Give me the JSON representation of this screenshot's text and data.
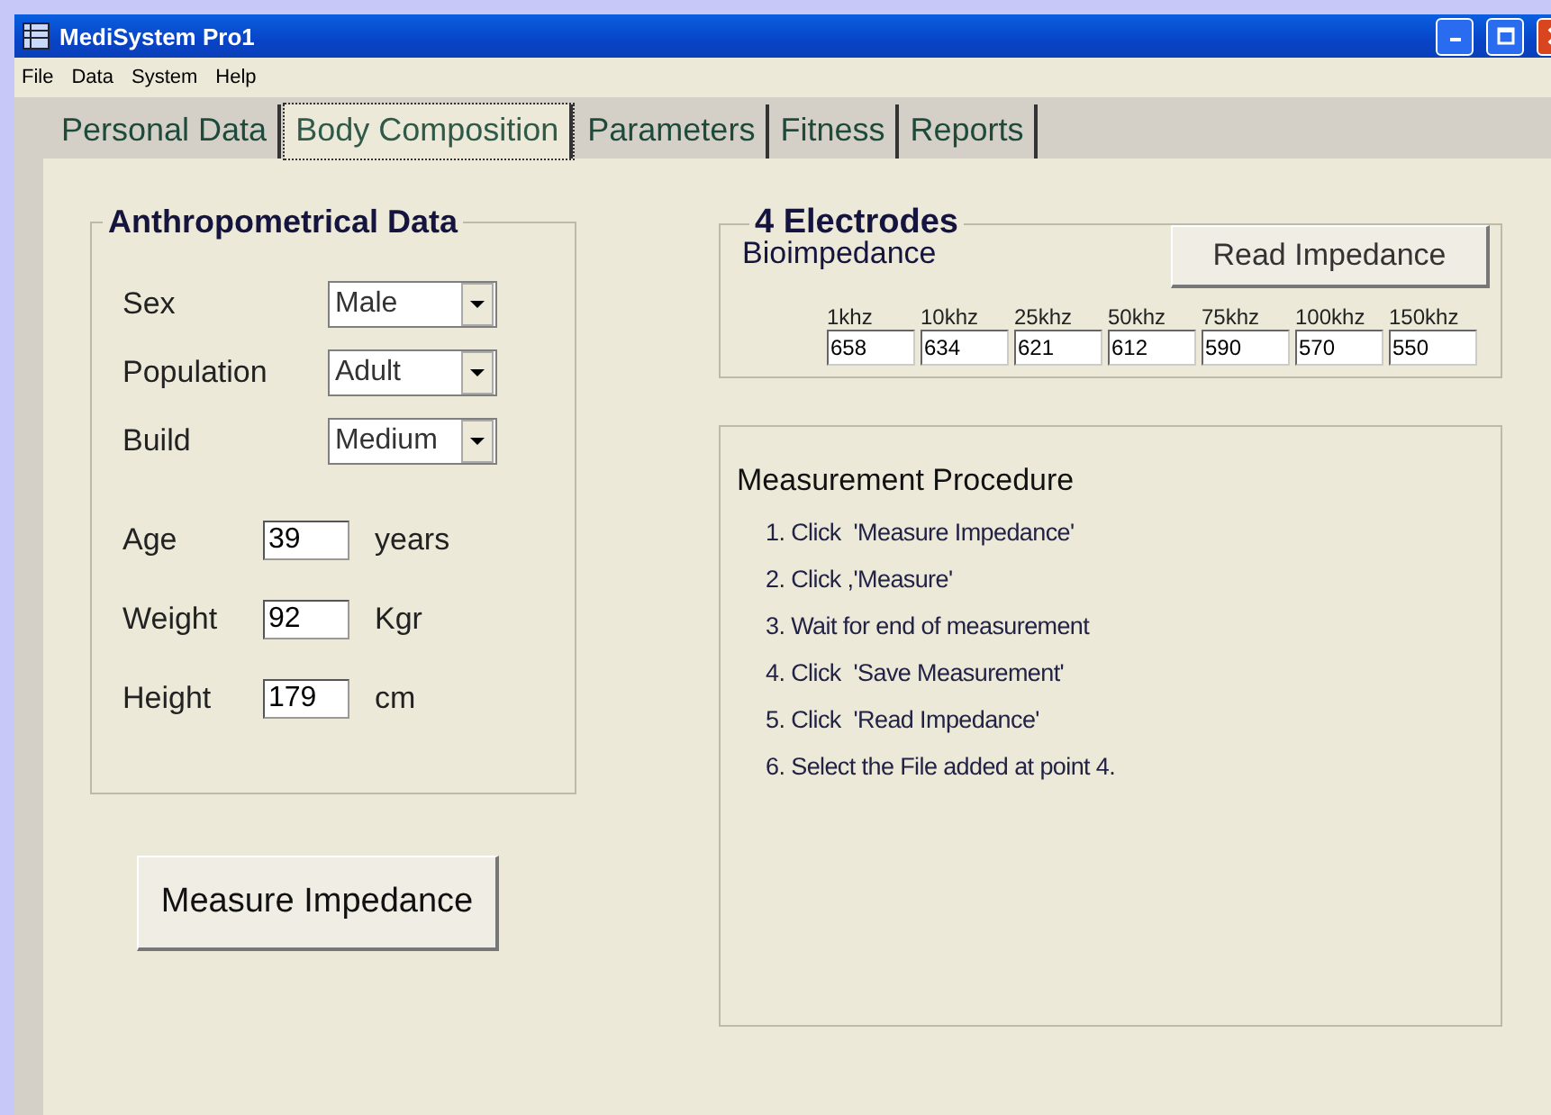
{
  "window": {
    "title": "MediSystem Pro1"
  },
  "menu": [
    "File",
    "Data",
    "System",
    "Help"
  ],
  "tabs": [
    {
      "label": "Personal Data",
      "selected": false
    },
    {
      "label": "Body Composition",
      "selected": true
    },
    {
      "label": "Parameters",
      "selected": false
    },
    {
      "label": "Fitness",
      "selected": false
    },
    {
      "label": "Reports",
      "selected": false
    }
  ],
  "anthropometrical": {
    "title": "Anthropometrical Data",
    "selects": [
      {
        "label": "Sex",
        "value": "Male"
      },
      {
        "label": "Population",
        "value": "Adult"
      },
      {
        "label": "Build",
        "value": "Medium"
      }
    ],
    "inputs": [
      {
        "label": "Age",
        "value": "39",
        "unit": "years"
      },
      {
        "label": "Weight",
        "value": "92",
        "unit": "Kgr"
      },
      {
        "label": "Height",
        "value": "179",
        "unit": "cm"
      }
    ]
  },
  "measure_button": "Measure Impedance",
  "electrodes": {
    "title": "4 Electrodes",
    "subtitle": "Bioimpedance",
    "button": "Read Impedance",
    "frequencies": [
      {
        "label": "1khz",
        "value": "658"
      },
      {
        "label": "10khz",
        "value": "634"
      },
      {
        "label": "25khz",
        "value": "621"
      },
      {
        "label": "50khz",
        "value": "612"
      },
      {
        "label": "75khz",
        "value": "590"
      },
      {
        "label": "100khz",
        "value": "570"
      },
      {
        "label": "150khz",
        "value": "550"
      }
    ]
  },
  "procedure": {
    "title": "Measurement Procedure",
    "steps": [
      "1. Click  'Measure Impedance'",
      "2. Click ,'Measure'",
      "3. Wait for end of measurement",
      "4. Click  'Save Measurement'",
      "5. Click  'Read Impedance'",
      "6. Select the File added at point 4."
    ]
  }
}
